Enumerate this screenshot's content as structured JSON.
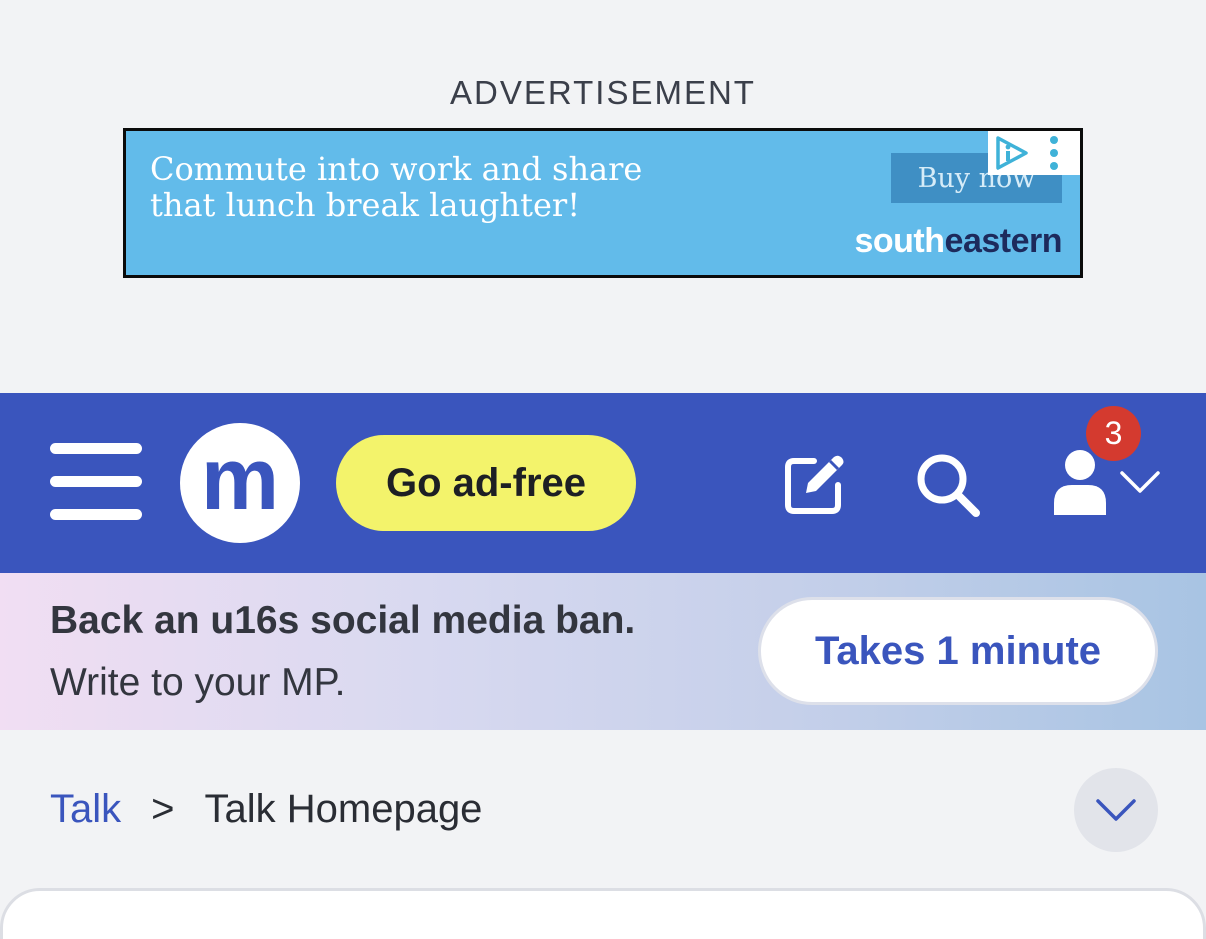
{
  "advertisement": {
    "label": "ADVERTISEMENT",
    "line1": "Commute into work and share",
    "line2": "that lunch break laughter!",
    "cta": "Buy now",
    "brand_part1": "south",
    "brand_part2": "eastern",
    "background_color": "#62bbea"
  },
  "header": {
    "logo_letter": "m",
    "adfree_label": "Go ad-free",
    "notification_count": "3",
    "brand_color": "#3a55bd",
    "adfree_color": "#f3f36b",
    "badge_color": "#d43a2f",
    "icons": [
      "menu-icon",
      "compose-icon",
      "search-icon",
      "user-icon",
      "chevron-down-icon"
    ]
  },
  "banner": {
    "title": "Back an u16s social media ban.",
    "subtitle": "Write to your MP.",
    "button_label": "Takes 1 minute"
  },
  "breadcrumb": {
    "root": "Talk",
    "separator": ">",
    "current": "Talk Homepage"
  }
}
